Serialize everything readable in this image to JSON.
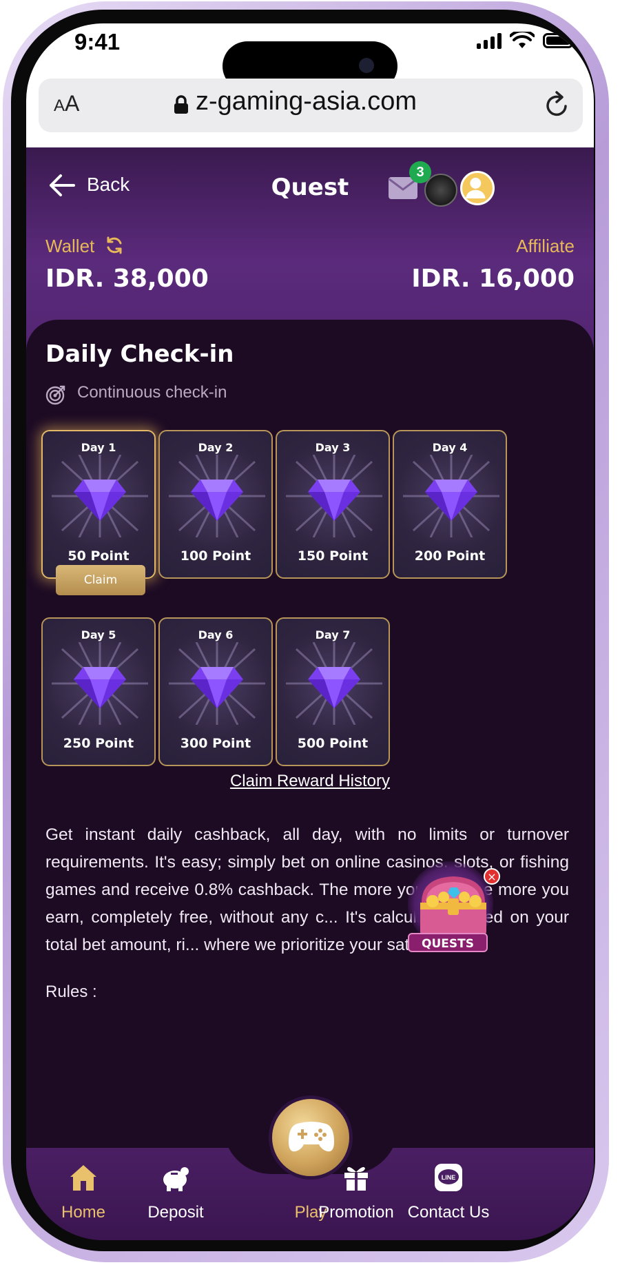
{
  "status_bar": {
    "time": "9:41"
  },
  "browser": {
    "aa_small": "A",
    "aa_big": "A",
    "url": "z-gaming-asia.com"
  },
  "header": {
    "back_label": "Back",
    "title": "Quest",
    "mail_badge_count": "3",
    "wallet_label": "Wallet",
    "wallet_amount": "IDR. 38,000",
    "affiliate_label": "Affiliate",
    "affiliate_amount": "IDR. 16,000"
  },
  "checkin": {
    "title": "Daily Check-in",
    "subtitle": "Continuous check-in",
    "days": [
      {
        "label": "Day 1",
        "points": "50 Point"
      },
      {
        "label": "Day 2",
        "points": "100 Point"
      },
      {
        "label": "Day 3",
        "points": "150 Point"
      },
      {
        "label": "Day 4",
        "points": "200 Point"
      },
      {
        "label": "Day 5",
        "points": "250 Point"
      },
      {
        "label": "Day 6",
        "points": "300 Point"
      },
      {
        "label": "Day 7",
        "points": "500 Point"
      }
    ],
    "claim_label": "Claim",
    "history_link": "Claim Reward History",
    "description": "Get instant daily cashback, all day, with no limits or turnover requirements. It's easy; simply bet on online casinos, slots, or fishing games and receive 0.8% cashback. The more you play, the more you earn, completely free, without any c... It's calculated based on your total bet amount, ri... where we prioritize your satisfaction.",
    "rules_label": "Rules :"
  },
  "quests_float": {
    "label": "QUESTS",
    "close": "×"
  },
  "bottom_nav": {
    "home": "Home",
    "deposit": "Deposit",
    "play": "Play",
    "promotion": "Promotion",
    "contact": "Contact Us",
    "line_text": "LINE"
  },
  "colors": {
    "accent_gold": "#e7b85a",
    "header_purple": "#5b2a7c",
    "panel_dark": "#1d0b24",
    "badge_green": "#1faa50"
  }
}
